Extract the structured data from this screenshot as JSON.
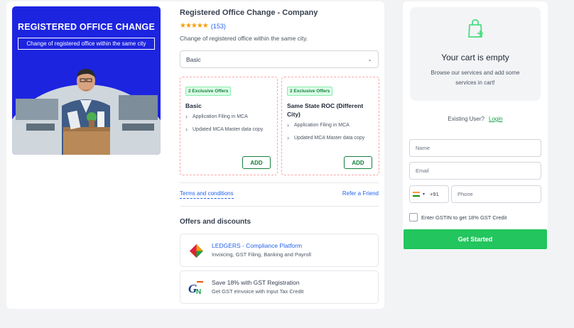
{
  "hero": {
    "title": "REGISTERED OFFICE CHANGE",
    "subtitle": "Change of registered office within the same city"
  },
  "product": {
    "title": "Registered Office Change - Company",
    "stars": "★★★★★",
    "rating_count": "(153)",
    "description": "Change of registered office within the same city.",
    "selected_plan": "Basic"
  },
  "plans": [
    {
      "badge": "2 Exclusive Offers",
      "name": "Basic",
      "features": [
        "Application Filing in MCA",
        "Updated MCA Master data copy"
      ],
      "button": "ADD"
    },
    {
      "badge": "2 Exclusive Offers",
      "name": "Same State ROC (Different City)",
      "features": [
        "Application Filing in MCA",
        "Updated MCA Master data copy"
      ],
      "button": "ADD"
    }
  ],
  "links": {
    "terms": "Terms and conditions",
    "refer": "Refer a Friend"
  },
  "offers": {
    "title": "Offers and discounts",
    "items": [
      {
        "heading": "LEDGERS - Compliance Platform",
        "sub": "Invoicing, GST Filing, Banking and Payroll",
        "icon": "ledgers-logo"
      },
      {
        "heading": "Save 18% with GST Registration",
        "sub": "Get GST eInvoice with Input Tax Credit",
        "icon": "gst-logo"
      }
    ]
  },
  "cart": {
    "title": "Your cart is empty",
    "description": "Browse our services and add some services in cart!",
    "existing_user": "Existing User?",
    "login": "Login",
    "name_placeholder": "Name",
    "email_placeholder": "Email",
    "country_code": "+91",
    "phone_placeholder": "Phone",
    "gst_label": "Enter GSTIN to get 18% GST Credit",
    "cta": "Get Started"
  },
  "colors": {
    "hero_bg": "#1d24e0",
    "accent_green": "#22c55e",
    "link_blue": "#2563eb",
    "star": "#f59e0b"
  }
}
